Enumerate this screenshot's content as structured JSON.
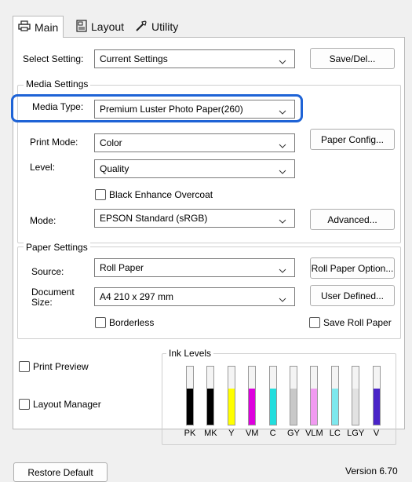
{
  "tabs": [
    {
      "label": "Main",
      "icon": "printer-icon"
    },
    {
      "label": "Layout",
      "icon": "layout-icon"
    },
    {
      "label": "Utility",
      "icon": "wrench-icon"
    }
  ],
  "select_setting": {
    "label": "Select Setting:",
    "value": "Current Settings",
    "button": "Save/Del..."
  },
  "media_settings": {
    "title": "Media Settings",
    "media_type": {
      "label": "Media Type:",
      "value": "Premium Luster Photo Paper(260)"
    },
    "print_mode": {
      "label": "Print Mode:",
      "value": "Color",
      "button": "Paper Config..."
    },
    "level": {
      "label": "Level:",
      "value": "Quality"
    },
    "black_enhance": {
      "label": "Black Enhance Overcoat",
      "checked": false
    },
    "mode": {
      "label": "Mode:",
      "value": "EPSON Standard (sRGB)",
      "button": "Advanced..."
    }
  },
  "paper_settings": {
    "title": "Paper Settings",
    "source": {
      "label": "Source:",
      "value": "Roll Paper",
      "button": "Roll Paper Option..."
    },
    "document_size": {
      "label_line1": "Document",
      "label_line2": "Size:",
      "value": "A4 210 x 297 mm",
      "button": "User Defined..."
    },
    "borderless": {
      "label": "Borderless",
      "checked": false
    },
    "save_roll_paper": {
      "label": "Save Roll Paper",
      "checked": false
    }
  },
  "print_preview": {
    "label": "Print Preview",
    "checked": false
  },
  "layout_manager": {
    "label": "Layout Manager",
    "checked": false
  },
  "ink_levels": {
    "title": "Ink Levels",
    "inks": [
      {
        "name": "PK",
        "color": "#000000",
        "level": 0.62
      },
      {
        "name": "MK",
        "color": "#000000",
        "level": 0.62
      },
      {
        "name": "Y",
        "color": "#ffff00",
        "level": 0.62
      },
      {
        "name": "VM",
        "color": "#dd00dd",
        "level": 0.62
      },
      {
        "name": "C",
        "color": "#22dddd",
        "level": 0.62
      },
      {
        "name": "GY",
        "color": "#c8c8c8",
        "level": 0.62
      },
      {
        "name": "VLM",
        "color": "#f09af0",
        "level": 0.62
      },
      {
        "name": "LC",
        "color": "#7de8ee",
        "level": 0.62
      },
      {
        "name": "LGY",
        "color": "#e2e2e2",
        "level": 0.62
      },
      {
        "name": "V",
        "color": "#4a24c8",
        "level": 0.62
      }
    ]
  },
  "footer": {
    "restore_default": "Restore Default",
    "version": "Version 6.70"
  }
}
